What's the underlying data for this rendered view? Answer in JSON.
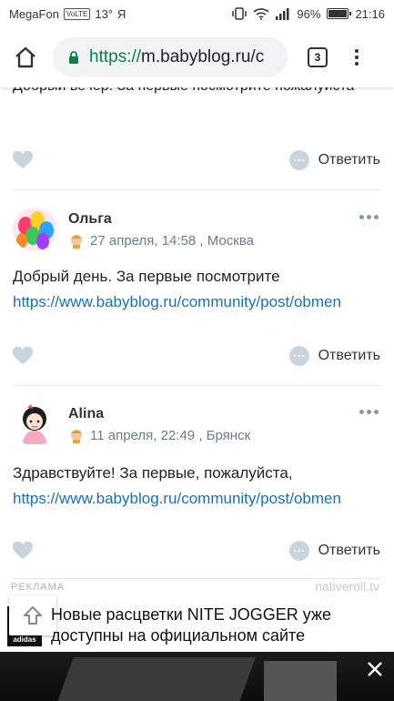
{
  "status_bar": {
    "carrier": "MegaFon",
    "volte": "VoLTE",
    "temp": "13°",
    "app": "Я",
    "battery": "96%",
    "battery_level": 0.96,
    "time": "21:16"
  },
  "browser": {
    "url_proto": "https://",
    "url_host": "m.babyblog.ru/c",
    "tab_count": "3"
  },
  "partial_comment": {
    "text": "Добрый вечер. За первые посмотрите пожалуйста",
    "reply_label": "Ответить"
  },
  "comments": [
    {
      "author": "Ольга",
      "date": "27 апреля, 14:58 , Москва",
      "text": "Добрый день. За первые посмотрите",
      "link": "https://www.babyblog.ru/community/post/obmen",
      "reply_label": "Ответить"
    },
    {
      "author": "Alina",
      "date": "11 апреля, 22:49 , Брянск",
      "text": "Здравствуйте! За первые, пожалуйста,",
      "link": "https://www.babyblog.ru/community/post/obmen",
      "reply_label": "Ответить"
    }
  ],
  "ad": {
    "label": "РЕКЛАМА",
    "source": "nativeroll.tv",
    "logo_text": "adidas",
    "title": "Новые расцветки NITE JOGGER уже доступны на официальном сайте"
  }
}
